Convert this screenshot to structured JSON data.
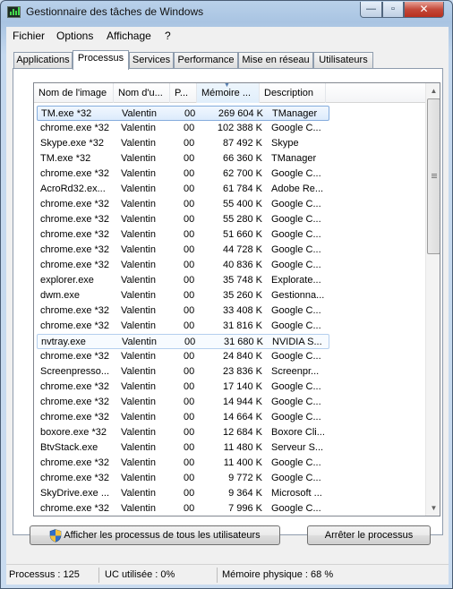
{
  "window": {
    "title": "Gestionnaire des tâches de Windows",
    "min_label": "—",
    "max_label": "▫",
    "close_label": "✕"
  },
  "menu": [
    "Fichier",
    "Options",
    "Affichage",
    "?"
  ],
  "tabs": [
    {
      "label": "Applications",
      "active": false
    },
    {
      "label": "Processus",
      "active": true
    },
    {
      "label": "Services",
      "active": false
    },
    {
      "label": "Performance",
      "active": false
    },
    {
      "label": "Mise en réseau",
      "active": false
    },
    {
      "label": "Utilisateurs",
      "active": false
    }
  ],
  "table": {
    "columns": [
      "Nom de l'image",
      "Nom d'u...",
      "P...",
      "Mémoire ...",
      "Description"
    ],
    "sorted_column": 3,
    "rows": [
      {
        "name": "TM.exe *32",
        "user": "Valentin",
        "cpu": "00",
        "mem": "269 604 K",
        "desc": "TManager",
        "state": "selected"
      },
      {
        "name": "chrome.exe *32",
        "user": "Valentin",
        "cpu": "00",
        "mem": "102 388 K",
        "desc": "Google C..."
      },
      {
        "name": "Skype.exe *32",
        "user": "Valentin",
        "cpu": "00",
        "mem": "87 492 K",
        "desc": "Skype"
      },
      {
        "name": "TM.exe *32",
        "user": "Valentin",
        "cpu": "00",
        "mem": "66 360 K",
        "desc": "TManager"
      },
      {
        "name": "chrome.exe *32",
        "user": "Valentin",
        "cpu": "00",
        "mem": "62 700 K",
        "desc": "Google C..."
      },
      {
        "name": "AcroRd32.ex...",
        "user": "Valentin",
        "cpu": "00",
        "mem": "61 784 K",
        "desc": "Adobe Re..."
      },
      {
        "name": "chrome.exe *32",
        "user": "Valentin",
        "cpu": "00",
        "mem": "55 400 K",
        "desc": "Google C..."
      },
      {
        "name": "chrome.exe *32",
        "user": "Valentin",
        "cpu": "00",
        "mem": "55 280 K",
        "desc": "Google C..."
      },
      {
        "name": "chrome.exe *32",
        "user": "Valentin",
        "cpu": "00",
        "mem": "51 660 K",
        "desc": "Google C..."
      },
      {
        "name": "chrome.exe *32",
        "user": "Valentin",
        "cpu": "00",
        "mem": "44 728 K",
        "desc": "Google C..."
      },
      {
        "name": "chrome.exe *32",
        "user": "Valentin",
        "cpu": "00",
        "mem": "40 836 K",
        "desc": "Google C..."
      },
      {
        "name": "explorer.exe",
        "user": "Valentin",
        "cpu": "00",
        "mem": "35 748 K",
        "desc": "Explorate..."
      },
      {
        "name": "dwm.exe",
        "user": "Valentin",
        "cpu": "00",
        "mem": "35 260 K",
        "desc": "Gestionna..."
      },
      {
        "name": "chrome.exe *32",
        "user": "Valentin",
        "cpu": "00",
        "mem": "33 408 K",
        "desc": "Google C..."
      },
      {
        "name": "chrome.exe *32",
        "user": "Valentin",
        "cpu": "00",
        "mem": "31 816 K",
        "desc": "Google C..."
      },
      {
        "name": "nvtray.exe",
        "user": "Valentin",
        "cpu": "00",
        "mem": "31 680 K",
        "desc": "NVIDIA S...",
        "state": "hover"
      },
      {
        "name": "chrome.exe *32",
        "user": "Valentin",
        "cpu": "00",
        "mem": "24 840 K",
        "desc": "Google C..."
      },
      {
        "name": "Screenpresso...",
        "user": "Valentin",
        "cpu": "00",
        "mem": "23 836 K",
        "desc": "Screenpr..."
      },
      {
        "name": "chrome.exe *32",
        "user": "Valentin",
        "cpu": "00",
        "mem": "17 140 K",
        "desc": "Google C..."
      },
      {
        "name": "chrome.exe *32",
        "user": "Valentin",
        "cpu": "00",
        "mem": "14 944 K",
        "desc": "Google C..."
      },
      {
        "name": "chrome.exe *32",
        "user": "Valentin",
        "cpu": "00",
        "mem": "14 664 K",
        "desc": "Google C..."
      },
      {
        "name": "boxore.exe *32",
        "user": "Valentin",
        "cpu": "00",
        "mem": "12 684 K",
        "desc": "Boxore Cli..."
      },
      {
        "name": "BtvStack.exe",
        "user": "Valentin",
        "cpu": "00",
        "mem": "11 480 K",
        "desc": "Serveur S..."
      },
      {
        "name": "chrome.exe *32",
        "user": "Valentin",
        "cpu": "00",
        "mem": "11 400 K",
        "desc": "Google C..."
      },
      {
        "name": "chrome.exe *32",
        "user": "Valentin",
        "cpu": "00",
        "mem": "9 772 K",
        "desc": "Google C..."
      },
      {
        "name": "SkyDrive.exe ...",
        "user": "Valentin",
        "cpu": "00",
        "mem": "9 364 K",
        "desc": "Microsoft ..."
      },
      {
        "name": "chrome.exe *32",
        "user": "Valentin",
        "cpu": "00",
        "mem": "7 996 K",
        "desc": "Google C..."
      }
    ]
  },
  "buttons": {
    "show_all": "Afficher les processus de tous les utilisateurs",
    "end_process": "Arrêter le processus"
  },
  "status": {
    "processes": "Processus : 125",
    "cpu": "UC utilisée : 0%",
    "memory": "Mémoire physique : 68 %"
  },
  "icons": {
    "app": "task-manager-icon",
    "shield": "uac-shield-icon",
    "scroll_up": "▲",
    "scroll_down": "▼"
  }
}
